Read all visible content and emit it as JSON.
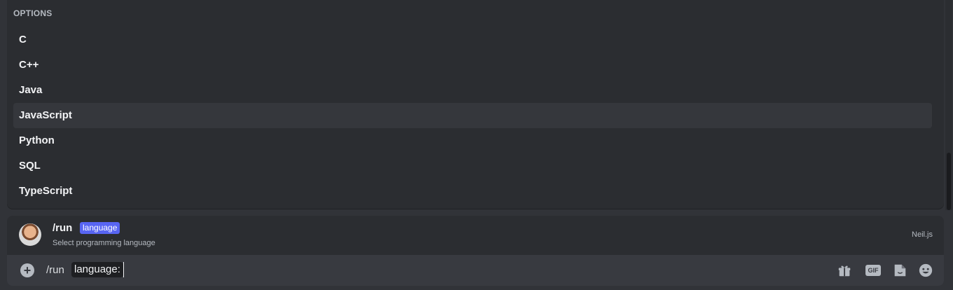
{
  "options": {
    "header": "OPTIONS",
    "items": [
      {
        "label": "C"
      },
      {
        "label": "C++"
      },
      {
        "label": "Java"
      },
      {
        "label": "JavaScript"
      },
      {
        "label": "Python"
      },
      {
        "label": "SQL"
      },
      {
        "label": "TypeScript"
      }
    ],
    "active_index": 3
  },
  "command": {
    "name": "/run",
    "param": "language",
    "description": "Select programming language",
    "app": "Neil.js"
  },
  "input": {
    "command": "/run",
    "param": "language:"
  },
  "toolbar": {
    "gif_label": "GIF",
    "icons": [
      "gift-icon",
      "gif-icon",
      "sticker-icon",
      "emoji-icon"
    ]
  },
  "colors": {
    "accent": "#5865f2",
    "panel_bg": "#2b2d31",
    "input_bg": "#383a40"
  }
}
